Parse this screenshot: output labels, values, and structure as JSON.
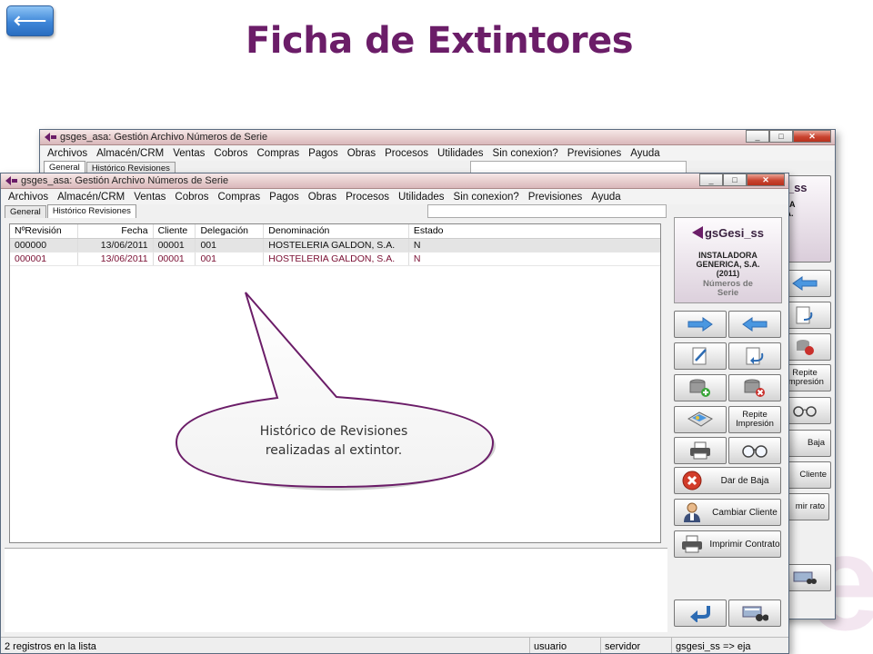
{
  "slide": {
    "back_symbol": "⟵",
    "title": "Ficha de Extintores"
  },
  "colors": {
    "title": "#6b1d68",
    "link_row": "#7a0f33"
  },
  "window_back": {
    "title": "gsges_asa: Gestión Archivo Números de Serie",
    "menu": [
      "Archivos",
      "Almacén/CRM",
      "Ventas",
      "Cobros",
      "Compras",
      "Pagos",
      "Obras",
      "Procesos",
      "Utilidades",
      "Sin conexion?",
      "Previsiones",
      "Ayuda"
    ],
    "tabs": [
      "General",
      "Histórico Revisiones"
    ],
    "logo_partial": "si_ss",
    "logo_partial_sub1": "DRA",
    "logo_partial_sub2": "S.A.",
    "logo_partial_sub3": "de",
    "btn_repite": "Repite Impresión",
    "btn_baja": "Baja",
    "btn_cliente": "Cliente",
    "btn_imprimir_partial": "mir rato"
  },
  "window_front": {
    "title": "gsges_asa: Gestión Archivo Números de Serie",
    "menu": [
      "Archivos",
      "Almacén/CRM",
      "Ventas",
      "Cobros",
      "Compras",
      "Pagos",
      "Obras",
      "Procesos",
      "Utilidades",
      "Sin conexion?",
      "Previsiones",
      "Ayuda"
    ],
    "tabs": [
      "General",
      "Histórico Revisiones"
    ],
    "columns": [
      "NºRevisión",
      "Fecha",
      "Cliente",
      "Delegación",
      "Denominación",
      "Estado"
    ],
    "rows": [
      [
        "000000",
        "13/06/2011",
        "00001",
        "001",
        "HOSTELERIA GALDON, S.A.",
        "N"
      ],
      [
        "000001",
        "13/06/2011",
        "00001",
        "001",
        "HOSTELERIA GALDON, S.A.",
        "N"
      ]
    ],
    "logo": {
      "brand": "gsGesi_ss",
      "company_line1": "INSTALADORA",
      "company_line2": "GENERICA, S.A.",
      "company_line3": "(2011)",
      "module_line1": "Números de",
      "module_line2": "Serie"
    },
    "buttons": {
      "repite_impresion": "Repite Impresión",
      "dar_de_baja": "Dar de Baja",
      "cambiar_cliente": "Cambiar Cliente",
      "imprimir_contrato": "Imprimir Contrato"
    },
    "status": {
      "count": "2 registros en la lista",
      "user": "usuario",
      "server": "servidor",
      "db": "gsgesi_ss => eja"
    }
  },
  "callout": {
    "line1": "Histórico de Revisiones",
    "line2": "realizadas al extintor."
  }
}
